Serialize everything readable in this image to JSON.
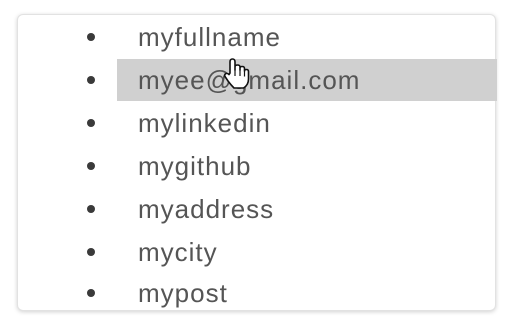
{
  "menu": {
    "items": [
      {
        "label": "myfullname"
      },
      {
        "label": "myee@gmail.com",
        "hovered": true
      },
      {
        "label": "mylinkedin"
      },
      {
        "label": "mygithub"
      },
      {
        "label": "myaddress"
      },
      {
        "label": "mycity"
      },
      {
        "label": "mypost"
      }
    ]
  },
  "cursor": {
    "icon": "hand-pointer-icon"
  },
  "colors": {
    "highlight": "#d0d0d0",
    "text": "#555555",
    "bullet": "#3a3a3a"
  }
}
